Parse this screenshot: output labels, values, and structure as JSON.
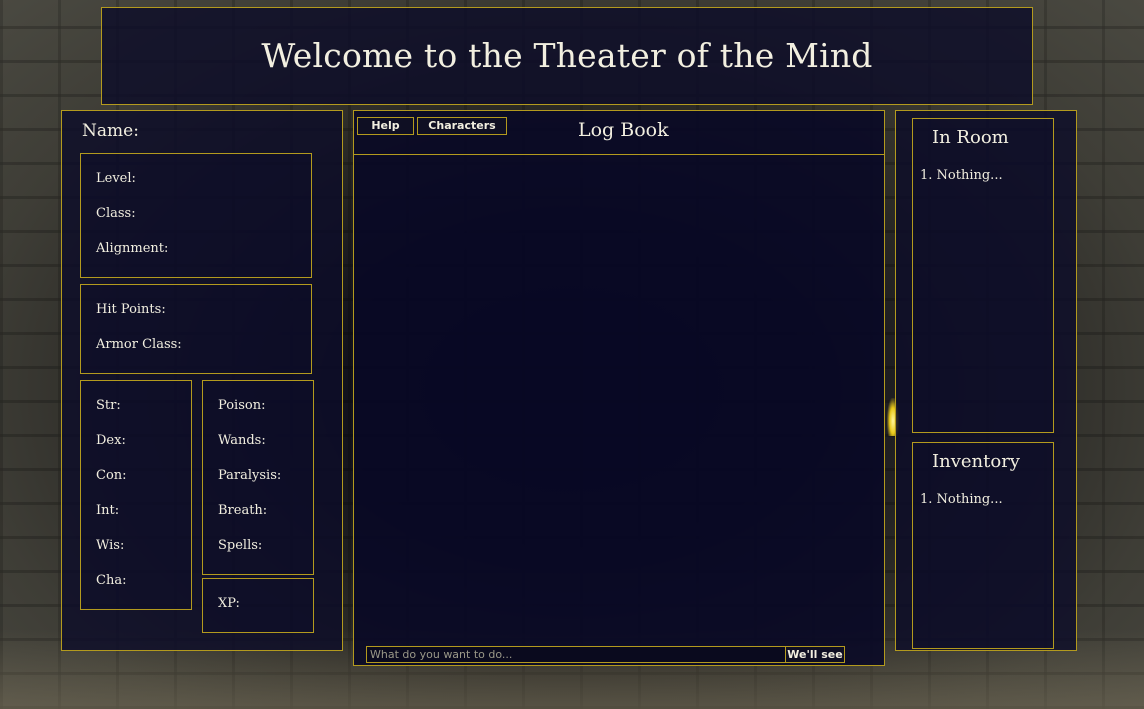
{
  "header": {
    "title": "Welcome to the Theater of the Mind"
  },
  "character": {
    "name_label": "Name:",
    "info": [
      "Level:",
      "Class:",
      "Alignment:"
    ],
    "combat": [
      "Hit Points:",
      "Armor Class:"
    ],
    "abilities": [
      "Str:",
      "Dex:",
      "Con:",
      "Int:",
      "Wis:",
      "Cha:"
    ],
    "saves": [
      "Poison:",
      "Wands:",
      "Paralysis:",
      "Breath:",
      "Spells:"
    ],
    "xp_label": "XP:"
  },
  "log": {
    "help_label": "Help",
    "characters_label": "Characters",
    "title": "Log Book",
    "input_placeholder": "What do you want to do...",
    "submit_label": "We'll see"
  },
  "room": {
    "title": "In Room",
    "items": [
      "1. Nothing..."
    ]
  },
  "inventory": {
    "title": "Inventory",
    "items": [
      "1. Nothing..."
    ]
  },
  "colors": {
    "border": "#b39a1e",
    "panel": "#0c0c28",
    "text": "#f2efe0"
  }
}
